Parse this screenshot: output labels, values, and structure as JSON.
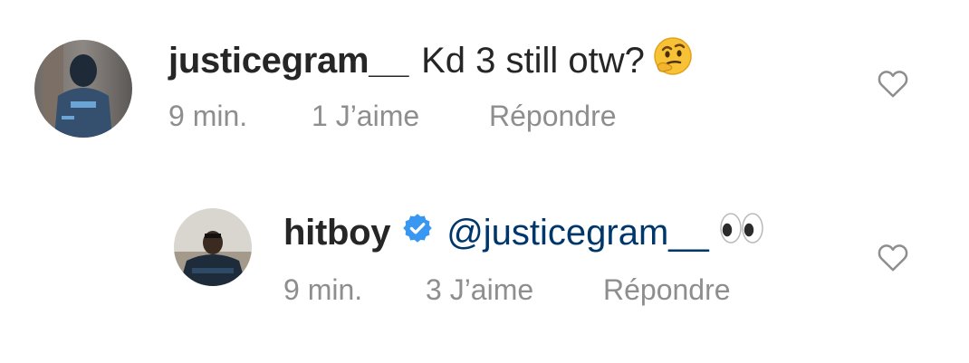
{
  "comments": [
    {
      "username": "justicegram__",
      "text": "Kd 3 still otw?",
      "emoji": "thinking-face",
      "time": "9 min.",
      "likes": "1 J’aime",
      "reply": "Répondre",
      "icon": "heart-outline"
    },
    {
      "username": "hitboy",
      "verified": true,
      "mention": "@justicegram__",
      "emoji": "eyes",
      "time": "9 min.",
      "likes": "3 J’aime",
      "reply": "Répondre",
      "icon": "heart-outline"
    }
  ],
  "colors": {
    "text": "#262626",
    "muted": "#8e8e8e",
    "mention": "#00376b",
    "verified": "#3897f0"
  }
}
